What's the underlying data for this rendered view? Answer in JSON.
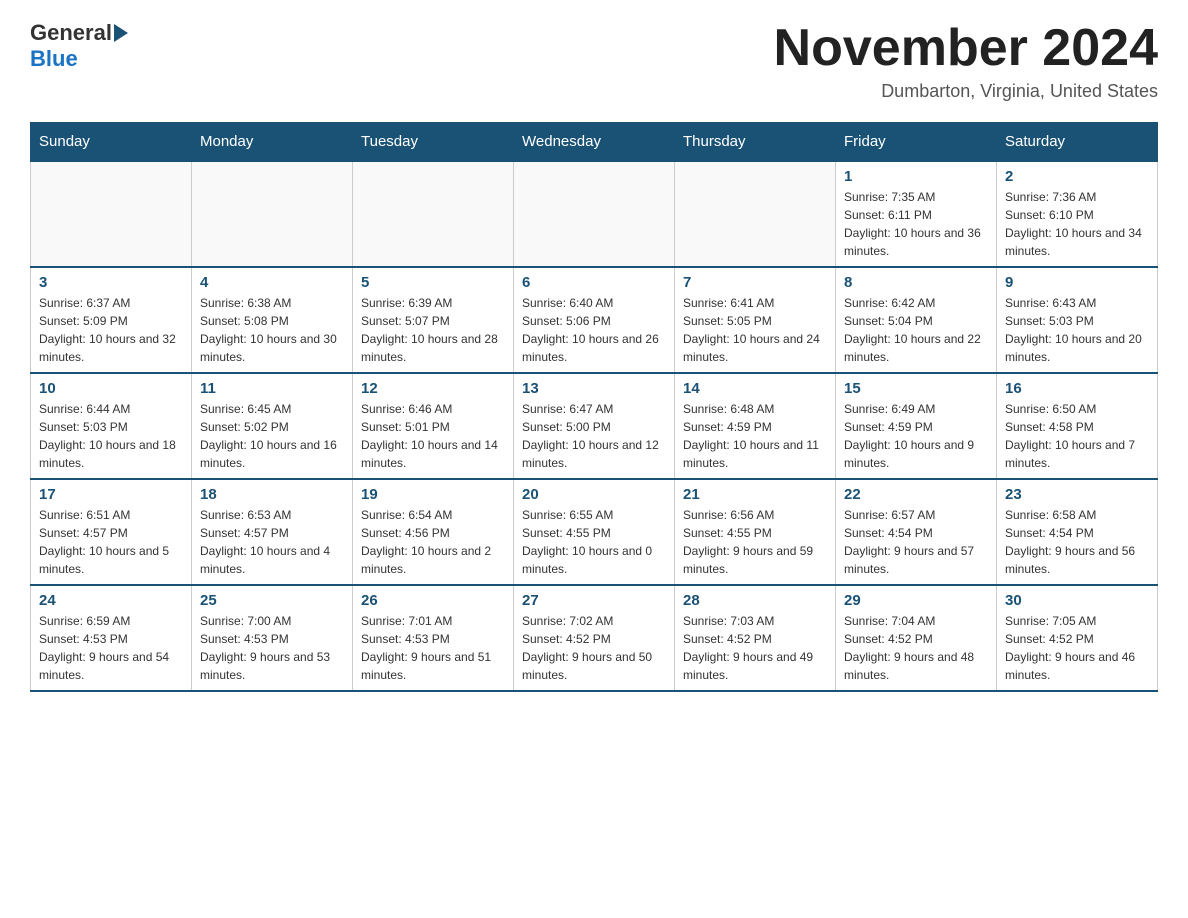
{
  "header": {
    "logo": {
      "general": "General",
      "blue": "Blue",
      "underline": "Blue"
    },
    "title": "November 2024",
    "location": "Dumbarton, Virginia, United States"
  },
  "weekdays": [
    "Sunday",
    "Monday",
    "Tuesday",
    "Wednesday",
    "Thursday",
    "Friday",
    "Saturday"
  ],
  "weeks": [
    [
      {
        "day": "",
        "info": ""
      },
      {
        "day": "",
        "info": ""
      },
      {
        "day": "",
        "info": ""
      },
      {
        "day": "",
        "info": ""
      },
      {
        "day": "",
        "info": ""
      },
      {
        "day": "1",
        "info": "Sunrise: 7:35 AM\nSunset: 6:11 PM\nDaylight: 10 hours and 36 minutes."
      },
      {
        "day": "2",
        "info": "Sunrise: 7:36 AM\nSunset: 6:10 PM\nDaylight: 10 hours and 34 minutes."
      }
    ],
    [
      {
        "day": "3",
        "info": "Sunrise: 6:37 AM\nSunset: 5:09 PM\nDaylight: 10 hours and 32 minutes."
      },
      {
        "day": "4",
        "info": "Sunrise: 6:38 AM\nSunset: 5:08 PM\nDaylight: 10 hours and 30 minutes."
      },
      {
        "day": "5",
        "info": "Sunrise: 6:39 AM\nSunset: 5:07 PM\nDaylight: 10 hours and 28 minutes."
      },
      {
        "day": "6",
        "info": "Sunrise: 6:40 AM\nSunset: 5:06 PM\nDaylight: 10 hours and 26 minutes."
      },
      {
        "day": "7",
        "info": "Sunrise: 6:41 AM\nSunset: 5:05 PM\nDaylight: 10 hours and 24 minutes."
      },
      {
        "day": "8",
        "info": "Sunrise: 6:42 AM\nSunset: 5:04 PM\nDaylight: 10 hours and 22 minutes."
      },
      {
        "day": "9",
        "info": "Sunrise: 6:43 AM\nSunset: 5:03 PM\nDaylight: 10 hours and 20 minutes."
      }
    ],
    [
      {
        "day": "10",
        "info": "Sunrise: 6:44 AM\nSunset: 5:03 PM\nDaylight: 10 hours and 18 minutes."
      },
      {
        "day": "11",
        "info": "Sunrise: 6:45 AM\nSunset: 5:02 PM\nDaylight: 10 hours and 16 minutes."
      },
      {
        "day": "12",
        "info": "Sunrise: 6:46 AM\nSunset: 5:01 PM\nDaylight: 10 hours and 14 minutes."
      },
      {
        "day": "13",
        "info": "Sunrise: 6:47 AM\nSunset: 5:00 PM\nDaylight: 10 hours and 12 minutes."
      },
      {
        "day": "14",
        "info": "Sunrise: 6:48 AM\nSunset: 4:59 PM\nDaylight: 10 hours and 11 minutes."
      },
      {
        "day": "15",
        "info": "Sunrise: 6:49 AM\nSunset: 4:59 PM\nDaylight: 10 hours and 9 minutes."
      },
      {
        "day": "16",
        "info": "Sunrise: 6:50 AM\nSunset: 4:58 PM\nDaylight: 10 hours and 7 minutes."
      }
    ],
    [
      {
        "day": "17",
        "info": "Sunrise: 6:51 AM\nSunset: 4:57 PM\nDaylight: 10 hours and 5 minutes."
      },
      {
        "day": "18",
        "info": "Sunrise: 6:53 AM\nSunset: 4:57 PM\nDaylight: 10 hours and 4 minutes."
      },
      {
        "day": "19",
        "info": "Sunrise: 6:54 AM\nSunset: 4:56 PM\nDaylight: 10 hours and 2 minutes."
      },
      {
        "day": "20",
        "info": "Sunrise: 6:55 AM\nSunset: 4:55 PM\nDaylight: 10 hours and 0 minutes."
      },
      {
        "day": "21",
        "info": "Sunrise: 6:56 AM\nSunset: 4:55 PM\nDaylight: 9 hours and 59 minutes."
      },
      {
        "day": "22",
        "info": "Sunrise: 6:57 AM\nSunset: 4:54 PM\nDaylight: 9 hours and 57 minutes."
      },
      {
        "day": "23",
        "info": "Sunrise: 6:58 AM\nSunset: 4:54 PM\nDaylight: 9 hours and 56 minutes."
      }
    ],
    [
      {
        "day": "24",
        "info": "Sunrise: 6:59 AM\nSunset: 4:53 PM\nDaylight: 9 hours and 54 minutes."
      },
      {
        "day": "25",
        "info": "Sunrise: 7:00 AM\nSunset: 4:53 PM\nDaylight: 9 hours and 53 minutes."
      },
      {
        "day": "26",
        "info": "Sunrise: 7:01 AM\nSunset: 4:53 PM\nDaylight: 9 hours and 51 minutes."
      },
      {
        "day": "27",
        "info": "Sunrise: 7:02 AM\nSunset: 4:52 PM\nDaylight: 9 hours and 50 minutes."
      },
      {
        "day": "28",
        "info": "Sunrise: 7:03 AM\nSunset: 4:52 PM\nDaylight: 9 hours and 49 minutes."
      },
      {
        "day": "29",
        "info": "Sunrise: 7:04 AM\nSunset: 4:52 PM\nDaylight: 9 hours and 48 minutes."
      },
      {
        "day": "30",
        "info": "Sunrise: 7:05 AM\nSunset: 4:52 PM\nDaylight: 9 hours and 46 minutes."
      }
    ]
  ]
}
